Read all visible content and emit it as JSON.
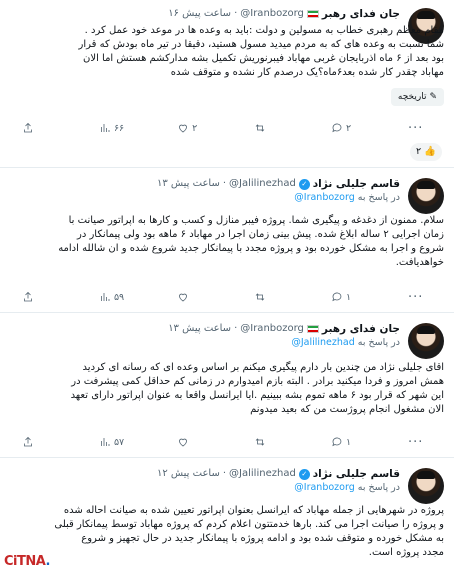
{
  "tweets": [
    {
      "name": "جان فدای رهبر",
      "handle": "@Iranbozorg",
      "time": "۱۶ ساعت پیش",
      "lines": [
        "مقام معظم رهبری خطاب به مسولین و دولت :باید به وعده ها در موعد خود عمل کرد .",
        "شما نسبت به وعده های که به مردم میدید مسول هستید، دقیقا در تیر ماه بودش که قرار",
        "بود بعد از ۶ ماه اذربایجان غربی مهاباد فیبرنوریش تکمیل بشه مدارکشم هستش اما الان",
        "مهاباد چقدر کار شده بعد۶ماه؟یک درصدم کار نشده و متوقف شده"
      ],
      "history_label": "تاریخچه",
      "reactions": {
        "replies": "۲",
        "retweets": "",
        "likes": "۲",
        "views": "۶۶"
      }
    },
    {
      "name": "قاسم جلیلی نژاد",
      "handle": "@Jalilinezhad",
      "time": "۱۳ ساعت پیش",
      "reply_prefix": "در پاسخ به",
      "reply_handle": "Iranbozorg@",
      "lines": [
        "سلام. ممنون از دغدغه و پیگیری شما. پروژه فیبر منازل و کسب و کارها به اپراتور صیانت با",
        "زمان اجرایی ۲ ساله ابلاغ شده. پیش بینی زمان اجرا در مهاباد ۶ ماهه بود ولی پیمانکار در",
        "شروع و اجرا به مشکل خورده بود و پروژه مجدد با پیمانکار جدید شروع شده و ان شالله ادامه",
        "خواهدیافت."
      ],
      "reactions": {
        "replies": "۱",
        "retweets": "",
        "likes": "",
        "views": "۵۹"
      }
    },
    {
      "name": "جان فدای رهبر",
      "handle": "@Iranbozorg",
      "time": "۱۳ ساعت پیش",
      "reply_prefix": "در پاسخ به",
      "reply_handle": "Jalilinezhad@",
      "lines": [
        "اقای جلیلی نژاد من چندین بار دارم پیگیری میکنم بر اساس وعده ای که رسانه ای کردید",
        "همش امروز و فردا میکنید برادر . البته بازم امیدوارم در زمانی کم حداقل کمی پیشرفت در",
        "این شهر که قرار بود ۶ ماهه تموم بشه ببینیم .ایا ایرانسل واقعا به عنوان اپراتور دارای تعهد",
        "الان مشغول انجام پروژست من که بعید میدونم"
      ],
      "reactions": {
        "replies": "۱",
        "retweets": "",
        "likes": "",
        "views": "۵۷"
      }
    },
    {
      "name": "قاسم جلیلی نژاد",
      "handle": "@Jalilinezhad",
      "time": "۱۲ ساعت پیش",
      "reply_prefix": "در پاسخ به",
      "reply_handle": "Iranbozorg@",
      "lines": [
        "پروژه در شهرهایی از جمله مهاباد که ایرانسل بعنوان اپراتور تعیین شده به صیانت احاله شده",
        "و پروژه را صیانت اجرا می کند. بارها خدمتتون اعلام کردم که پروژه مهاباد توسط پیمانکار قبلی",
        "به مشکل خورده و متوقف شده بود و ادامه پروژه با پیمانکار جدید در حال تجهیز و شروع",
        "مجدد پروژه است."
      ]
    }
  ],
  "reaction_chip": {
    "emoji": "👍",
    "count": "۲"
  },
  "watermark": {
    "main": "CiTNA",
    "dot": "."
  },
  "colors": {
    "accent": "#1d9bf0",
    "text": "#0f1419",
    "muted": "#536471",
    "divider": "#e6ecf0"
  }
}
